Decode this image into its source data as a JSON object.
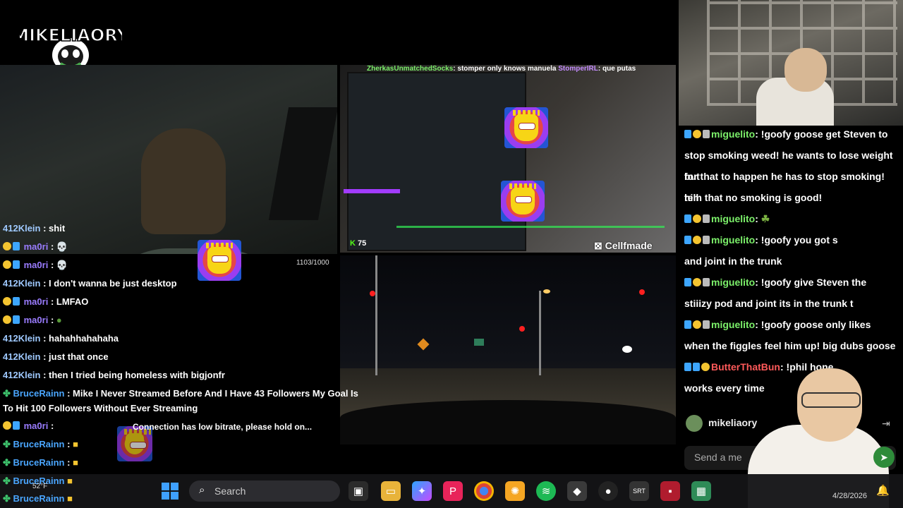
{
  "logo_text": "MIKELIAORY",
  "stream_ticker": {
    "user1": "ZherkasUnmatchedSocks",
    "msg1": ": stomper only knows manuela",
    "user2": "StomperIRL",
    "msg2": ": que putas"
  },
  "kick_viewers": "75",
  "cellfmade_tag": "Cellfmade",
  "counter": "1103/1000",
  "connection_notice": "Connection has low bitrate, please hold on...",
  "left_chat": [
    {
      "user": "412Klein",
      "text": " : shit"
    },
    {
      "user": "ma0ri",
      "text": " :"
    },
    {
      "user": "ma0ri",
      "text": " :"
    },
    {
      "user": "412Klein",
      "text": " : I don't wanna be just desktop"
    },
    {
      "user": "ma0ri",
      "text": " : LMFAO"
    },
    {
      "user": "ma0ri",
      "text": " :"
    },
    {
      "user": "412Klein",
      "text": " : hahahhahahaha"
    },
    {
      "user": "412Klein",
      "text": " : just that once"
    },
    {
      "user": "412Klein",
      "text": " : then I tried being homeless with bigjonfr"
    },
    {
      "user": "BruceRainn",
      "text": " : Mike I Never Streamed Before And I Have 43 Followers My Goal Is"
    },
    {
      "user": "",
      "text": "To Hit 100 Followers Without Ever Streaming"
    },
    {
      "user": "ma0ri",
      "text": " :"
    },
    {
      "user": "BruceRainn",
      "text": " :"
    },
    {
      "user": "BruceRainn",
      "text": " :"
    },
    {
      "user": "BruceRainn",
      "text": ""
    },
    {
      "user": "BruceRainn",
      "text": ""
    }
  ],
  "right_chat": [
    {
      "user": "miguelito",
      "text": ": !goofy goose get Steven to"
    },
    {
      "user": "",
      "text": "stop smoking weed! he wants to lose weight but"
    },
    {
      "user": "",
      "text": "for that to happen he has to stop smoking! tell"
    },
    {
      "user": "",
      "text": "him that no smoking is good!"
    },
    {
      "user": "miguelito",
      "text": ":"
    },
    {
      "user": "miguelito",
      "text": ": !goofy you got s"
    },
    {
      "user": "",
      "text": "and joint in the trunk"
    },
    {
      "user": "miguelito",
      "text": ": !goofy give Steven the"
    },
    {
      "user": "",
      "text": "stiiizy pod and joint its in the trunk t"
    },
    {
      "user": "miguelito",
      "text": ": !goofy goose only likes"
    },
    {
      "user": "",
      "text": "when the figgles feel him up! big dubs goose"
    },
    {
      "user": "ButterThatBun",
      "text": ": !phil hone"
    },
    {
      "user": "",
      "text": "works every time"
    }
  ],
  "self_username": "mikeliaory",
  "send_placeholder": "Send a me",
  "taskbar": {
    "search_label": "Search",
    "date": "4/28/2026",
    "weather": "52°F"
  },
  "colors": {
    "accent_green": "#7cf06a",
    "accent_blue": "#4aa6ff",
    "kick_green": "#53fc18"
  }
}
